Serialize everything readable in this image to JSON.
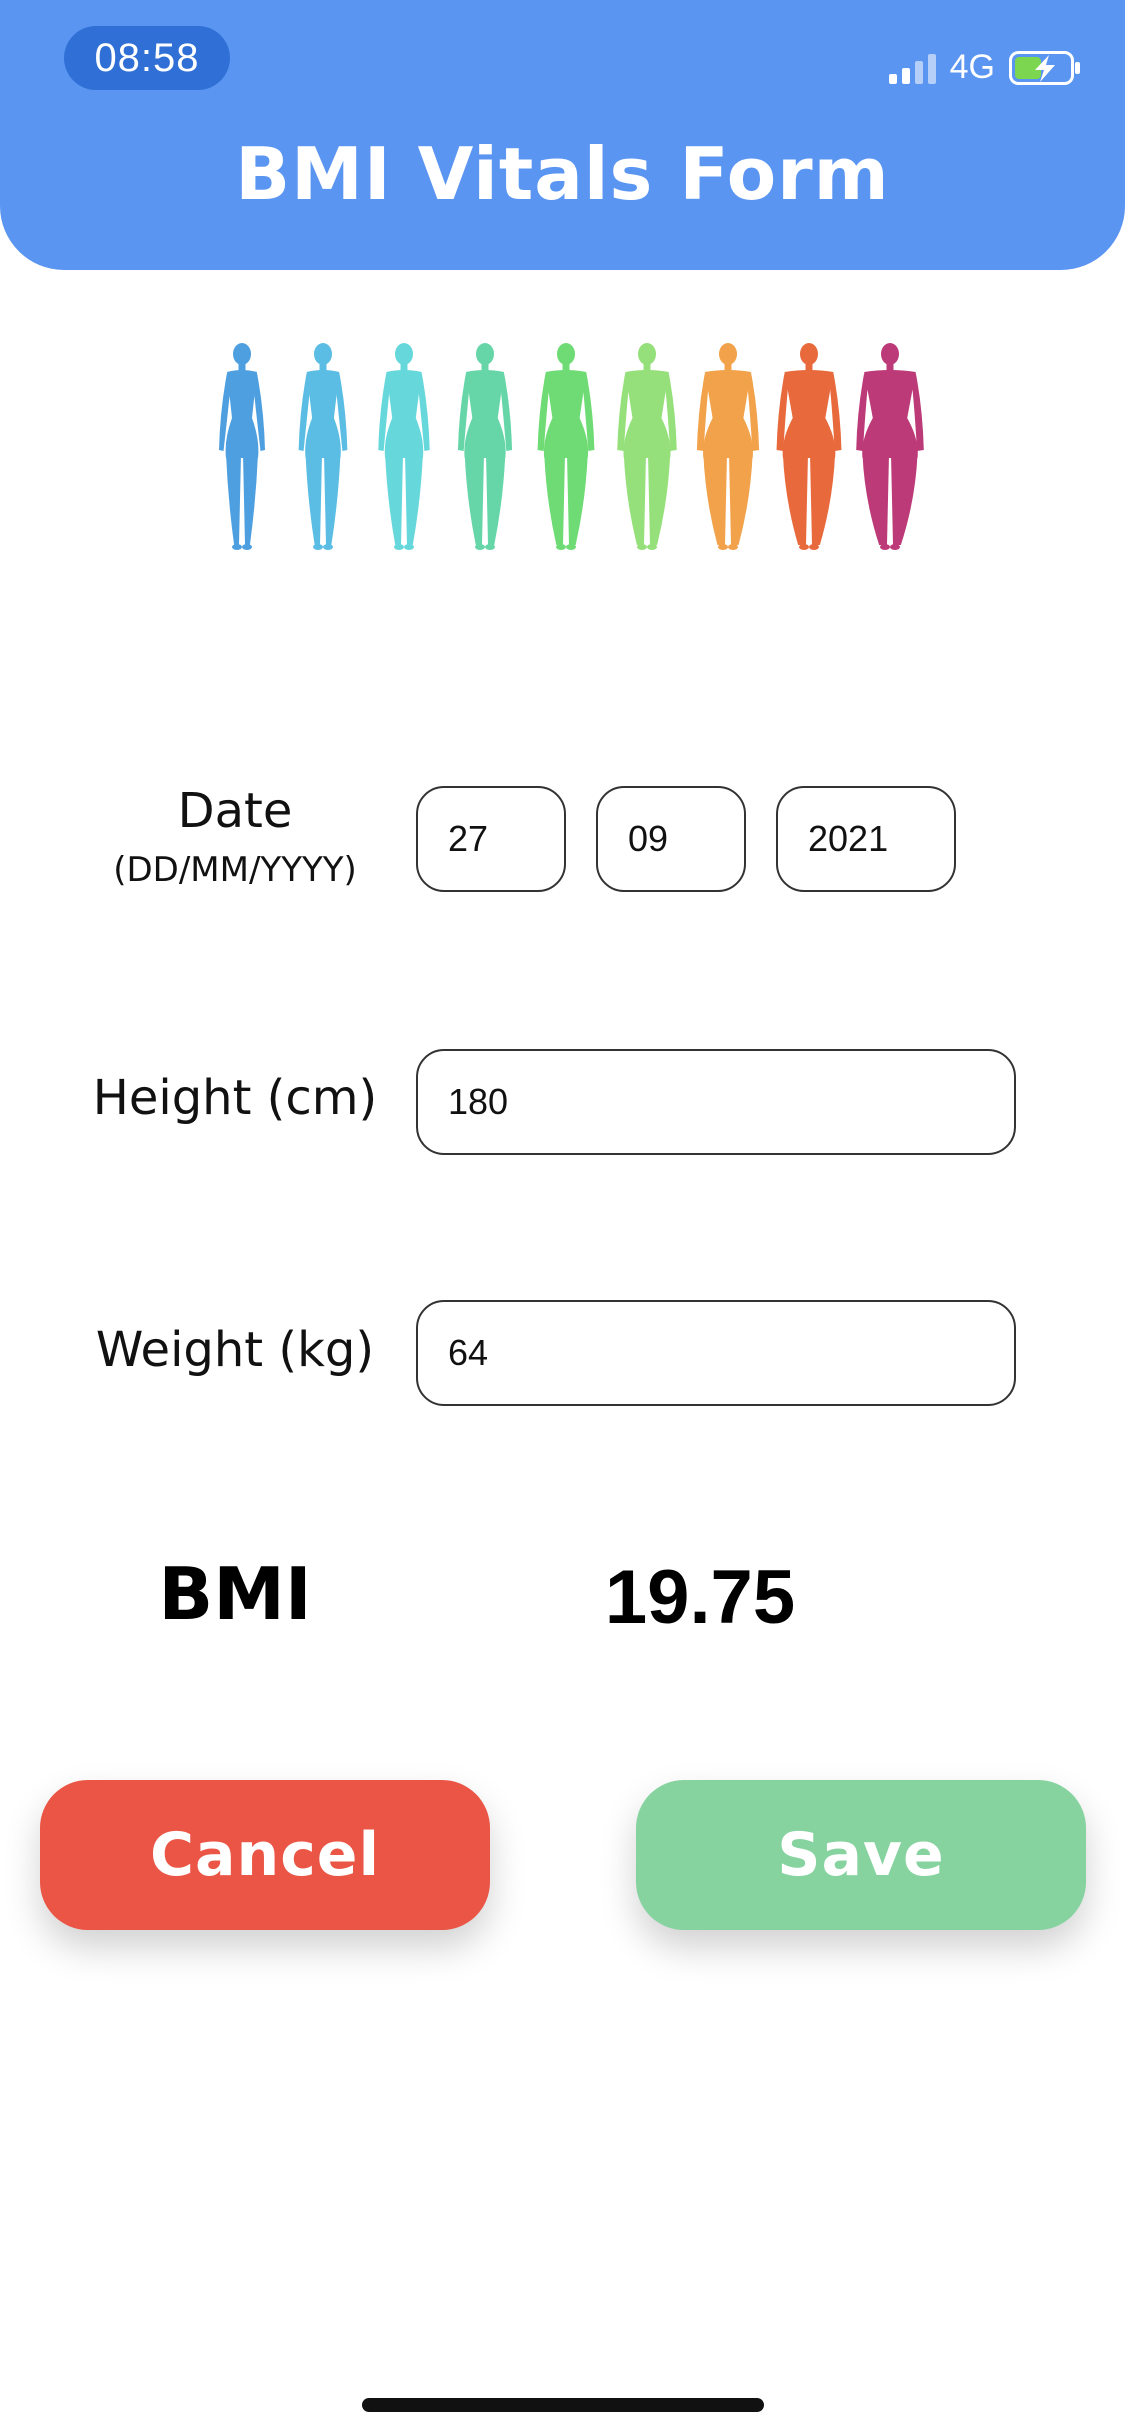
{
  "status_bar": {
    "time": "08:58",
    "network": "4G",
    "icons": [
      "signal-icon",
      "battery-charging-icon"
    ]
  },
  "header": {
    "title": "BMI Vitals Form",
    "color": "#5b95f2"
  },
  "illustration": {
    "icon": "body-shapes-illustration",
    "figure_colors": [
      "#4e9fe0",
      "#5bbde3",
      "#66d8dc",
      "#66d6a9",
      "#6edb74",
      "#95e07a",
      "#f2a24a",
      "#e86a3c",
      "#bd3a78"
    ]
  },
  "form": {
    "date": {
      "label": "Date",
      "format": "(DD/MM/YYYY)",
      "day": "27",
      "month": "09",
      "year": "2021"
    },
    "height": {
      "label": "Height (cm)",
      "value": "180"
    },
    "weight": {
      "label": "Weight (kg)",
      "value": "64"
    }
  },
  "result": {
    "label": "BMI",
    "value": "19.75"
  },
  "actions": {
    "cancel": {
      "label": "Cancel",
      "color": "#eb5545"
    },
    "save": {
      "label": "Save",
      "color": "#86d3a0"
    }
  }
}
